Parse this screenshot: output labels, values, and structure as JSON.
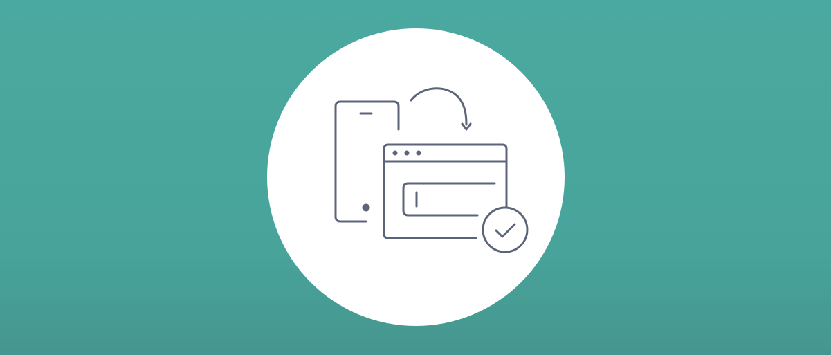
{
  "banner": {
    "background_color": "#48a49b",
    "circle_color": "#ffffff",
    "icon_stroke_color": "#5c6479"
  },
  "illustration": {
    "icons": [
      "smartphone-icon",
      "curved-arrow-icon",
      "browser-window-icon",
      "input-field-icon",
      "checkmark-circle-icon"
    ]
  }
}
